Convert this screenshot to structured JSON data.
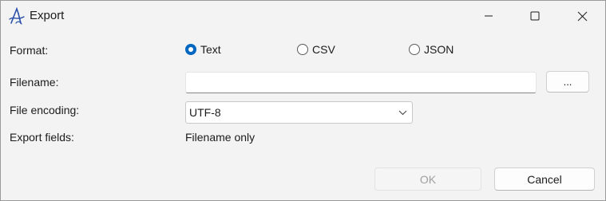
{
  "window": {
    "title": "Export"
  },
  "format": {
    "label": "Format:",
    "options": [
      {
        "label": "Text",
        "checked": true
      },
      {
        "label": "CSV",
        "checked": false
      },
      {
        "label": "JSON",
        "checked": false
      }
    ]
  },
  "filename": {
    "label": "Filename:",
    "value": "",
    "browse_label": "..."
  },
  "encoding": {
    "label": "File encoding:",
    "selected": "UTF-8"
  },
  "export_fields": {
    "label": "Export fields:",
    "value": "Filename only"
  },
  "buttons": {
    "ok_label": "OK",
    "ok_enabled": false,
    "cancel_label": "Cancel"
  },
  "colors": {
    "accent": "#0067c0",
    "window_bg": "#f3f3f3"
  }
}
